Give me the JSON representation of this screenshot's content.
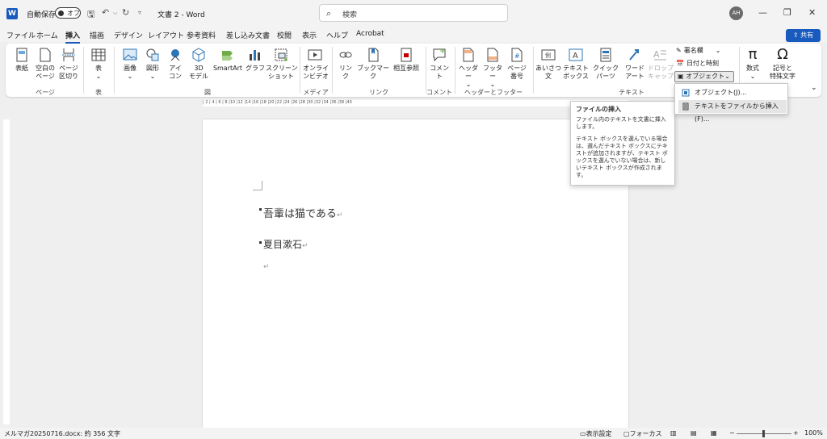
{
  "titlebar": {
    "logo": "W",
    "autosave_label": "自動保存",
    "autosave_state": "オフ",
    "doc_title": "文書 2  -  Word",
    "search_placeholder": "検索",
    "avatar": "AH",
    "share": "共有"
  },
  "menu": [
    "ファイル",
    "ホーム",
    "挿入",
    "描画",
    "デザイン",
    "レイアウト",
    "参考資料",
    "差し込み文書",
    "校閲",
    "表示",
    "ヘルプ",
    "Acrobat"
  ],
  "ribbon": {
    "buttons": {
      "cover": "表紙",
      "blank": "空白の\nページ",
      "pagebreak": "ページ\n区切り",
      "table": "表",
      "picture": "画像",
      "shapes": "図形",
      "icons": "アイ\nコン",
      "model3d": "3D\nモデル",
      "smartart": "SmartArt",
      "graph": "グラフ",
      "screenshot": "スクリーン\nショット",
      "video": "オンライ\nンビデオ",
      "link": "リン\nク",
      "bookmark": "ブックマーク",
      "crossref": "相互参照",
      "comment": "コメント",
      "header": "ヘッダー",
      "footer": "フッター",
      "pagenum": "ページ\n番号",
      "greeting": "あいさつ\n文",
      "textbox": "テキスト\nボックス",
      "quickparts": "クイック パーツ",
      "wordart": "ワード\nアート",
      "dropcap": "ドロップ\nキャップ",
      "equation": "数式",
      "symbol": "記号と\n特殊文字"
    },
    "small": {
      "signature": "署名欄",
      "datetime": "日付と時刻",
      "object": "オブジェクト"
    },
    "groups": {
      "pages": "ページ",
      "table": "表",
      "illustrations": "図",
      "media": "メディア",
      "links": "リンク",
      "comments": "コメント",
      "headerfooter": "ヘッダーとフッター",
      "text": "テキスト"
    }
  },
  "ruler": "| 2 | 4 | 6 | 8 |10 |12 |14 |16 |18 |20 |22 |24 |26 |28 |30 |32 |34 |36 |38 |40",
  "document": {
    "line1": "吾輩は猫である",
    "line2": "夏目漱石"
  },
  "tooltip": {
    "title": "ファイルの挿入",
    "p1": "ファイル内のテキストを文書に挿入します。",
    "p2": "テキスト ボックスを選んでいる場合は、選んだテキスト ボックスにテキストが追加されますが、テキスト ボックスを選んでいない場合は、新しいテキスト ボックスが作成されます。"
  },
  "dropdown": [
    "オブジェクト(J)...",
    "テキストをファイルから挿入(F)..."
  ],
  "status": {
    "left": "メルマガ20250716.docx: 約 356 文字",
    "display": "表示設定",
    "focus": "フォーカス",
    "zoom": "100%"
  }
}
